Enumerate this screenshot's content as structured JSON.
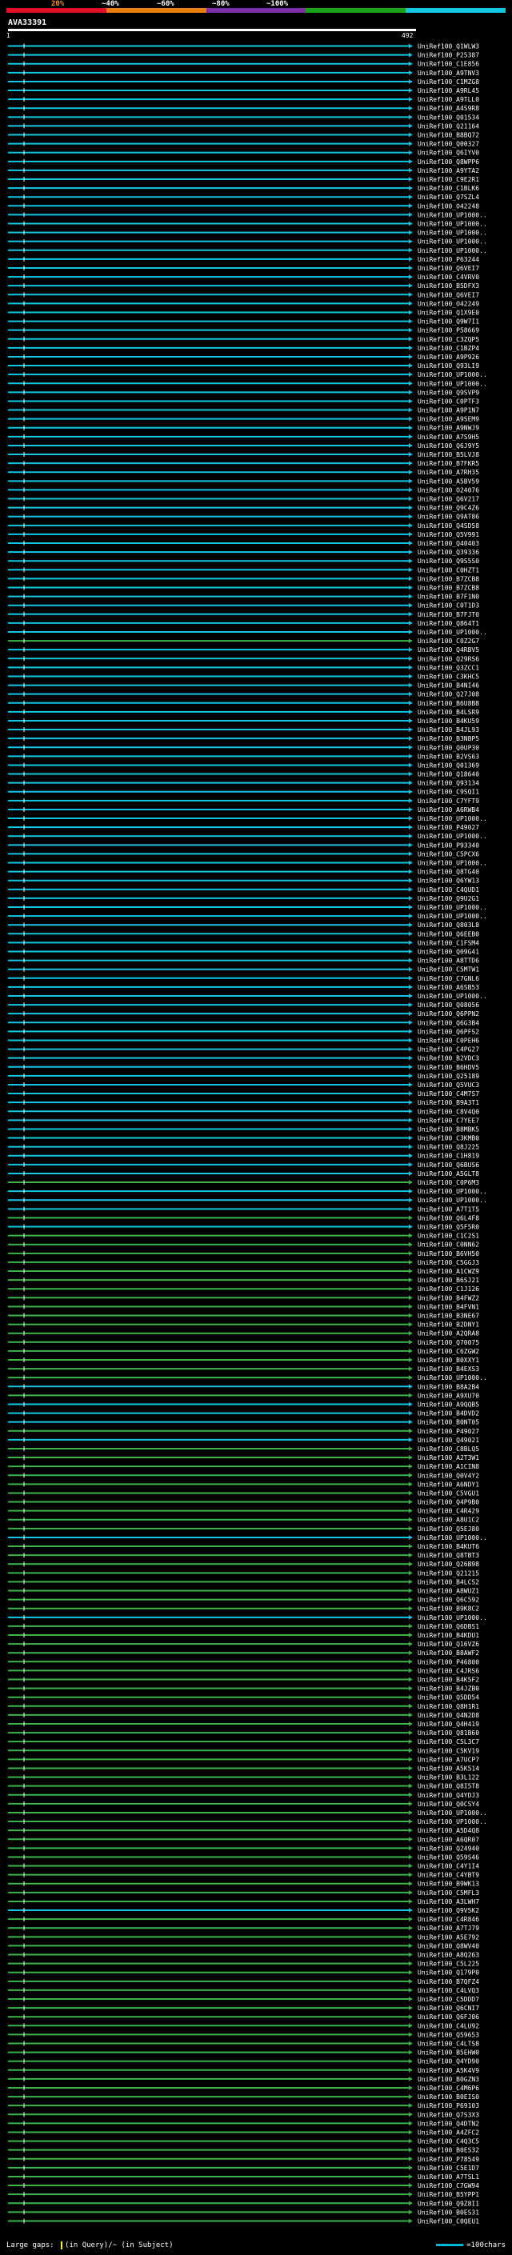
{
  "scale": {
    "labels": [
      "20%",
      "~40%",
      "~60%",
      "~80%",
      "~100%"
    ],
    "colors": [
      "#e0102a",
      "#e87d10",
      "#7d2fa8",
      "#1aa31a",
      "#13c6e2"
    ]
  },
  "query": {
    "id": "AVA33391",
    "start": "1",
    "end": "492"
  },
  "hit_colors": {
    "high": "#13c6e2",
    "medium": "#39b54a",
    "low": "#7a7a7a",
    "gap": "#ffff00",
    "insert": "#c040c0"
  },
  "hits": [
    {
      "label": "UniRef100_Q1WLW3",
      "color": "high"
    },
    {
      "label": "UniRef100_P25387",
      "color": "high"
    },
    {
      "label": "UniRef100_C1E856",
      "color": "high"
    },
    {
      "label": "UniRef100_A9TNV3",
      "color": "high"
    },
    {
      "label": "UniRef100_C1MZG8",
      "color": "high"
    },
    {
      "label": "UniRef100_A9RL45",
      "color": "high"
    },
    {
      "label": "UniRef100_A9TLL0",
      "color": "high"
    },
    {
      "label": "UniRef100_A4S9R8",
      "color": "high"
    },
    {
      "label": "UniRef100_Q01534",
      "color": "high"
    },
    {
      "label": "UniRef100_Q21164",
      "color": "high"
    },
    {
      "label": "UniRef100_B8BQ72",
      "color": "high"
    },
    {
      "label": "UniRef100_Q00327",
      "color": "high"
    },
    {
      "label": "UniRef100_Q6IYV0",
      "color": "high"
    },
    {
      "label": "UniRef100_Q8WPP6",
      "color": "high"
    },
    {
      "label": "UniRef100_A9YTA2",
      "color": "high"
    },
    {
      "label": "UniRef100_C9E2R1",
      "color": "high"
    },
    {
      "label": "UniRef100_C1BLK6",
      "color": "high"
    },
    {
      "label": "UniRef100_Q7SZL4",
      "color": "high"
    },
    {
      "label": "UniRef100_O42248",
      "color": "high"
    },
    {
      "label": "UniRef100_UP1000..",
      "color": "high"
    },
    {
      "label": "UniRef100_UP1000..",
      "color": "high"
    },
    {
      "label": "UniRef100_UP1000..",
      "color": "high"
    },
    {
      "label": "UniRef100_UP1000..",
      "color": "high"
    },
    {
      "label": "UniRef100_UP1000..",
      "color": "high"
    },
    {
      "label": "UniRef100_P63244",
      "color": "high"
    },
    {
      "label": "UniRef100_Q6VEI7",
      "color": "high"
    },
    {
      "label": "UniRef100_C4VRV0",
      "color": "high"
    },
    {
      "label": "UniRef100_B5DFX3",
      "color": "high"
    },
    {
      "label": "UniRef100_Q6VEI7",
      "color": "high"
    },
    {
      "label": "UniRef100_O42249",
      "color": "high"
    },
    {
      "label": "UniRef100_Q1X9E0",
      "color": "high"
    },
    {
      "label": "UniRef100_Q9W7I1",
      "color": "high"
    },
    {
      "label": "UniRef100_P58669",
      "color": "high"
    },
    {
      "label": "UniRef100_C3ZQP5",
      "color": "high"
    },
    {
      "label": "UniRef100_C1BZP4",
      "color": "high"
    },
    {
      "label": "UniRef100_A9P926",
      "color": "high"
    },
    {
      "label": "UniRef100_Q93LI9",
      "color": "high"
    },
    {
      "label": "UniRef100_UP1000..",
      "color": "high"
    },
    {
      "label": "UniRef100_UP1000..",
      "color": "high"
    },
    {
      "label": "UniRef100_Q9SVP9",
      "color": "high"
    },
    {
      "label": "UniRef100_C0PTF3",
      "color": "high"
    },
    {
      "label": "UniRef100_A9P1N7",
      "color": "high"
    },
    {
      "label": "UniRef100_A9SEM9",
      "color": "high"
    },
    {
      "label": "UniRef100_A9NWJ9",
      "color": "high"
    },
    {
      "label": "UniRef100_A7S9H5",
      "color": "high"
    },
    {
      "label": "UniRef100_Q6J9Y5",
      "color": "high"
    },
    {
      "label": "UniRef100_B5LVJ8",
      "color": "high"
    },
    {
      "label": "UniRef100_B7FKR5",
      "color": "high"
    },
    {
      "label": "UniRef100_A7RH35",
      "color": "high"
    },
    {
      "label": "UniRef100_A5BV59",
      "color": "high"
    },
    {
      "label": "UniRef100_O24076",
      "color": "high"
    },
    {
      "label": "UniRef100_Q6V217",
      "color": "high"
    },
    {
      "label": "UniRef100_Q9C4Z6",
      "color": "high"
    },
    {
      "label": "UniRef100_Q9AT86",
      "color": "high"
    },
    {
      "label": "UniRef100_Q4SD58",
      "color": "high"
    },
    {
      "label": "UniRef100_Q5V991",
      "color": "high"
    },
    {
      "label": "UniRef100_Q40403",
      "color": "high"
    },
    {
      "label": "UniRef100_Q39336",
      "color": "high"
    },
    {
      "label": "UniRef100_Q9S5S0",
      "color": "high"
    },
    {
      "label": "UniRef100_C0HZT1",
      "color": "high"
    },
    {
      "label": "UniRef100_B7ZCB8",
      "color": "high"
    },
    {
      "label": "UniRef100_B7ZCB8",
      "color": "high"
    },
    {
      "label": "UniRef100_B7F1N0",
      "color": "high"
    },
    {
      "label": "UniRef100_C0T1D3",
      "color": "high"
    },
    {
      "label": "UniRef100_B7FJT0",
      "color": "high"
    },
    {
      "label": "UniRef100_Q864T1",
      "color": "high"
    },
    {
      "label": "UniRef100_UP1000..",
      "color": "high"
    },
    {
      "label": "UniRef100_C0Z2G7",
      "color": "medium"
    },
    {
      "label": "UniRef100_Q4RBV5",
      "color": "high"
    },
    {
      "label": "UniRef100_Q29RS6",
      "color": "high"
    },
    {
      "label": "UniRef100_Q3ZCC1",
      "color": "high"
    },
    {
      "label": "UniRef100_C3KHC5",
      "color": "high"
    },
    {
      "label": "UniRef100_B4NI46",
      "color": "high"
    },
    {
      "label": "UniRef100_Q27J08",
      "color": "high"
    },
    {
      "label": "UniRef100_B6U8B8",
      "color": "high"
    },
    {
      "label": "UniRef100_B4LSR9",
      "color": "high"
    },
    {
      "label": "UniRef100_B4KU59",
      "color": "high"
    },
    {
      "label": "UniRef100_B4JL93",
      "color": "high"
    },
    {
      "label": "UniRef100_B3NBP5",
      "color": "high"
    },
    {
      "label": "UniRef100_Q0UP30",
      "color": "high"
    },
    {
      "label": "UniRef100_B2VS63",
      "color": "high"
    },
    {
      "label": "UniRef100_Q01369",
      "color": "high"
    },
    {
      "label": "UniRef100_Q18640",
      "color": "high"
    },
    {
      "label": "UniRef100_Q93134",
      "color": "high"
    },
    {
      "label": "UniRef100_C9SQI1",
      "color": "high"
    },
    {
      "label": "UniRef100_C7YFT9",
      "color": "high"
    },
    {
      "label": "UniRef100_A6RWB4",
      "color": "high"
    },
    {
      "label": "UniRef100_UP1000..",
      "color": "high"
    },
    {
      "label": "UniRef100_P49027",
      "color": "high"
    },
    {
      "label": "UniRef100_UP1000..",
      "color": "high"
    },
    {
      "label": "UniRef100_P93340",
      "color": "high"
    },
    {
      "label": "UniRef100_C5PCX6",
      "color": "high"
    },
    {
      "label": "UniRef100_UP1000..",
      "color": "high"
    },
    {
      "label": "UniRef100_Q8TG40",
      "color": "high"
    },
    {
      "label": "UniRef100_Q6YW13",
      "color": "high"
    },
    {
      "label": "UniRef100_C4QUD1",
      "color": "high"
    },
    {
      "label": "UniRef100_Q9U2G1",
      "color": "high"
    },
    {
      "label": "UniRef100_UP1000..",
      "color": "high"
    },
    {
      "label": "UniRef100_UP1000..",
      "color": "high"
    },
    {
      "label": "UniRef100_Q803L8",
      "color": "high"
    },
    {
      "label": "UniRef100_Q6EEB0",
      "color": "high"
    },
    {
      "label": "UniRef100_C1FSM4",
      "color": "high"
    },
    {
      "label": "UniRef100_Q09G41",
      "color": "high"
    },
    {
      "label": "UniRef100_A8TTD6",
      "color": "high"
    },
    {
      "label": "UniRef100_C5MTW1",
      "color": "high"
    },
    {
      "label": "UniRef100_C7GNL6",
      "color": "high"
    },
    {
      "label": "UniRef100_A6SB53",
      "color": "high"
    },
    {
      "label": "UniRef100_UP1000..",
      "color": "high"
    },
    {
      "label": "UniRef100_Q08056",
      "color": "high"
    },
    {
      "label": "UniRef100_Q6PPN2",
      "color": "high"
    },
    {
      "label": "UniRef100_Q6G3B4",
      "color": "high"
    },
    {
      "label": "UniRef100_Q6PFS2",
      "color": "high"
    },
    {
      "label": "UniRef100_C0PEH6",
      "color": "high"
    },
    {
      "label": "UniRef100_C4PG27",
      "color": "high"
    },
    {
      "label": "UniRef100_B2VDC3",
      "color": "high"
    },
    {
      "label": "UniRef100_B6HDV5",
      "color": "high"
    },
    {
      "label": "UniRef100_Q25189",
      "color": "high"
    },
    {
      "label": "UniRef100_Q5VUC3",
      "color": "high"
    },
    {
      "label": "UniRef100_C4M7S7",
      "color": "high"
    },
    {
      "label": "UniRef100_B9A3T1",
      "color": "high"
    },
    {
      "label": "UniRef100_C8V4Q0",
      "color": "high"
    },
    {
      "label": "UniRef100_C7YEE7",
      "color": "high"
    },
    {
      "label": "UniRef100_B8MBK5",
      "color": "high"
    },
    {
      "label": "UniRef100_C3KMB0",
      "color": "high"
    },
    {
      "label": "UniRef100_Q8J225",
      "color": "high"
    },
    {
      "label": "UniRef100_C1H819",
      "color": "high"
    },
    {
      "label": "UniRef100_Q6BUS6",
      "color": "high"
    },
    {
      "label": "UniRef100_A5GLT8",
      "color": "high"
    },
    {
      "label": "UniRef100_C0P6M3",
      "color": "medium"
    },
    {
      "label": "UniRef100_UP1000..",
      "color": "high"
    },
    {
      "label": "UniRef100_UP1000..",
      "color": "high"
    },
    {
      "label": "UniRef100_A7T1T5",
      "color": "high"
    },
    {
      "label": "UniRef100_Q6L4F8",
      "color": "medium"
    },
    {
      "label": "UniRef100_Q5F5R0",
      "color": "high"
    },
    {
      "label": "UniRef100_C1C2S1",
      "color": "medium"
    },
    {
      "label": "UniRef100_C0NN62",
      "color": "medium"
    },
    {
      "label": "UniRef100_B6VH50",
      "color": "medium"
    },
    {
      "label": "UniRef100_C5GGJ3",
      "color": "medium"
    },
    {
      "label": "UniRef100_A1CWZ9",
      "color": "medium"
    },
    {
      "label": "UniRef100_B6SJ21",
      "color": "medium"
    },
    {
      "label": "UniRef100_C1J126",
      "color": "medium"
    },
    {
      "label": "UniRef100_B4FWZ2",
      "color": "medium"
    },
    {
      "label": "UniRef100_B4FVN1",
      "color": "medium"
    },
    {
      "label": "UniRef100_B3NE67",
      "color": "medium"
    },
    {
      "label": "UniRef100_B2DNY1",
      "color": "medium"
    },
    {
      "label": "UniRef100_A2QRA8",
      "color": "medium"
    },
    {
      "label": "UniRef100_Q70075",
      "color": "medium"
    },
    {
      "label": "UniRef100_C6ZGW2",
      "color": "medium"
    },
    {
      "label": "UniRef100_B0XXY1",
      "color": "medium"
    },
    {
      "label": "UniRef100_B4EXS3",
      "color": "medium"
    },
    {
      "label": "UniRef100_UP1000..",
      "color": "medium"
    },
    {
      "label": "UniRef100_B8A2B4",
      "color": "high"
    },
    {
      "label": "UniRef100_A9XU70",
      "color": "medium"
    },
    {
      "label": "UniRef100_A9QQB5",
      "color": "high"
    },
    {
      "label": "UniRef100_B4DVD2",
      "color": "high"
    },
    {
      "label": "UniRef100_B0NT05",
      "color": "high"
    },
    {
      "label": "UniRef100_P49027",
      "color": "medium"
    },
    {
      "label": "UniRef100_Q49021",
      "color": "high"
    },
    {
      "label": "UniRef100_C8BLQ5",
      "color": "medium"
    },
    {
      "label": "UniRef100_A2T3W1",
      "color": "medium"
    },
    {
      "label": "UniRef100_A1CIN8",
      "color": "medium"
    },
    {
      "label": "UniRef100_Q0V4Y2",
      "color": "medium"
    },
    {
      "label": "UniRef100_A6NDY1",
      "color": "medium"
    },
    {
      "label": "UniRef100_C5VGU1",
      "color": "medium"
    },
    {
      "label": "UniRef100_Q4P9B0",
      "color": "medium"
    },
    {
      "label": "UniRef100_C4R429",
      "color": "medium"
    },
    {
      "label": "UniRef100_A8U1C2",
      "color": "medium"
    },
    {
      "label": "UniRef100_Q5EJ80",
      "color": "medium"
    },
    {
      "label": "UniRef100_UP1000..",
      "color": "high"
    },
    {
      "label": "UniRef100_B4KUT6",
      "color": "medium"
    },
    {
      "label": "UniRef100_Q8TBT3",
      "color": "medium"
    },
    {
      "label": "UniRef100_Q26B98",
      "color": "medium"
    },
    {
      "label": "UniRef100_Q21215",
      "color": "medium"
    },
    {
      "label": "UniRef100_B4LCS2",
      "color": "medium"
    },
    {
      "label": "UniRef100_A8WUZ1",
      "color": "medium"
    },
    {
      "label": "UniRef100_Q6C592",
      "color": "medium"
    },
    {
      "label": "UniRef100_B9K8C2",
      "color": "medium"
    },
    {
      "label": "UniRef100_UP1000..",
      "color": "high"
    },
    {
      "label": "UniRef100_Q6DBS1",
      "color": "medium"
    },
    {
      "label": "UniRef100_B4KDU1",
      "color": "medium"
    },
    {
      "label": "UniRef100_Q16VZ6",
      "color": "medium"
    },
    {
      "label": "UniRef100_B8AWF2",
      "color": "medium"
    },
    {
      "label": "UniRef100_P46800",
      "color": "medium"
    },
    {
      "label": "UniRef100_C4JRS6",
      "color": "medium"
    },
    {
      "label": "UniRef100_B4K5F2",
      "color": "medium"
    },
    {
      "label": "UniRef100_B4JZB0",
      "color": "medium"
    },
    {
      "label": "UniRef100_Q5DD54",
      "color": "medium"
    },
    {
      "label": "UniRef100_Q8H1R1",
      "color": "medium"
    },
    {
      "label": "UniRef100_Q4N2D8",
      "color": "medium"
    },
    {
      "label": "UniRef100_Q4H419",
      "color": "medium"
    },
    {
      "label": "UniRef100_Q81B60",
      "color": "medium"
    },
    {
      "label": "UniRef100_C5L3C7",
      "color": "medium"
    },
    {
      "label": "UniRef100_C5KV19",
      "color": "medium"
    },
    {
      "label": "UniRef100_A7UCP7",
      "color": "medium"
    },
    {
      "label": "UniRef100_A5K514",
      "color": "medium"
    },
    {
      "label": "UniRef100_B3L122",
      "color": "medium"
    },
    {
      "label": "UniRef100_Q8I5T8",
      "color": "medium"
    },
    {
      "label": "UniRef100_Q4YDJ3",
      "color": "medium"
    },
    {
      "label": "UniRef100_Q0CSY4",
      "color": "medium"
    },
    {
      "label": "UniRef100_UP1000..",
      "color": "medium"
    },
    {
      "label": "UniRef100_UP1000..",
      "color": "medium"
    },
    {
      "label": "UniRef100_A5D4Q8",
      "color": "medium"
    },
    {
      "label": "UniRef100_A6QR07",
      "color": "medium"
    },
    {
      "label": "UniRef100_Q24940",
      "color": "medium"
    },
    {
      "label": "UniRef100_Q59S46",
      "color": "medium"
    },
    {
      "label": "UniRef100_C4Y1I4",
      "color": "medium"
    },
    {
      "label": "UniRef100_C4YBT9",
      "color": "medium"
    },
    {
      "label": "UniRef100_B9WK13",
      "color": "medium"
    },
    {
      "label": "UniRef100_C5MFL3",
      "color": "medium"
    },
    {
      "label": "UniRef100_A3LWH7",
      "color": "medium"
    },
    {
      "label": "UniRef100_Q9V5K2",
      "color": "high"
    },
    {
      "label": "UniRef100_C4R846",
      "color": "medium"
    },
    {
      "label": "UniRef100_A7TJ79",
      "color": "medium"
    },
    {
      "label": "UniRef100_A5E792",
      "color": "medium"
    },
    {
      "label": "UniRef100_Q8WV40",
      "color": "medium"
    },
    {
      "label": "UniRef100_A8Q263",
      "color": "medium"
    },
    {
      "label": "UniRef100_C5L225",
      "color": "medium"
    },
    {
      "label": "UniRef100_Q179P0",
      "color": "medium"
    },
    {
      "label": "UniRef100_B7QFZ4",
      "color": "medium"
    },
    {
      "label": "UniRef100_C4LVQ3",
      "color": "medium"
    },
    {
      "label": "UniRef100_C5DDD7",
      "color": "medium"
    },
    {
      "label": "UniRef100_Q6CNI7",
      "color": "medium"
    },
    {
      "label": "UniRef100_Q6FJ06",
      "color": "medium"
    },
    {
      "label": "UniRef100_C4LU92",
      "color": "medium"
    },
    {
      "label": "UniRef100_Q59653",
      "color": "medium"
    },
    {
      "label": "UniRef100_C4LTS8",
      "color": "medium"
    },
    {
      "label": "UniRef100_B5EHW0",
      "color": "medium"
    },
    {
      "label": "UniRef100_Q4YD90",
      "color": "medium"
    },
    {
      "label": "UniRef100_A5K4V9",
      "color": "medium"
    },
    {
      "label": "UniRef100_B0GZN3",
      "color": "medium"
    },
    {
      "label": "UniRef100_C4M6P6",
      "color": "medium"
    },
    {
      "label": "UniRef100_B0EIS0",
      "color": "medium"
    },
    {
      "label": "UniRef100_P69103",
      "color": "medium"
    },
    {
      "label": "UniRef100_Q7S3X3",
      "color": "medium"
    },
    {
      "label": "UniRef100_Q4DTN2",
      "color": "medium"
    },
    {
      "label": "UniRef100_A4ZFC2",
      "color": "medium"
    },
    {
      "label": "UniRef100_C4Q3C5",
      "color": "medium"
    },
    {
      "label": "UniRef100_B0ES32",
      "color": "medium"
    },
    {
      "label": "UniRef100_P78549",
      "color": "medium"
    },
    {
      "label": "UniRef100_C5E1D7",
      "color": "medium"
    },
    {
      "label": "UniRef100_A7TSL1",
      "color": "medium"
    },
    {
      "label": "UniRef100_C7GW94",
      "color": "medium"
    },
    {
      "label": "UniRef100_B5YPP1",
      "color": "medium"
    },
    {
      "label": "UniRef100_Q9Z8I1",
      "color": "medium"
    },
    {
      "label": "UniRef100_B0ES31",
      "color": "medium"
    },
    {
      "label": "UniRef100_C0QEU1",
      "color": "medium"
    }
  ],
  "footer": {
    "left_text": "Large gaps: ",
    "query_gap_label": "(in Query)",
    "subject_gap_label": "/~ (in Subject)",
    "key_text": "=100chars"
  }
}
